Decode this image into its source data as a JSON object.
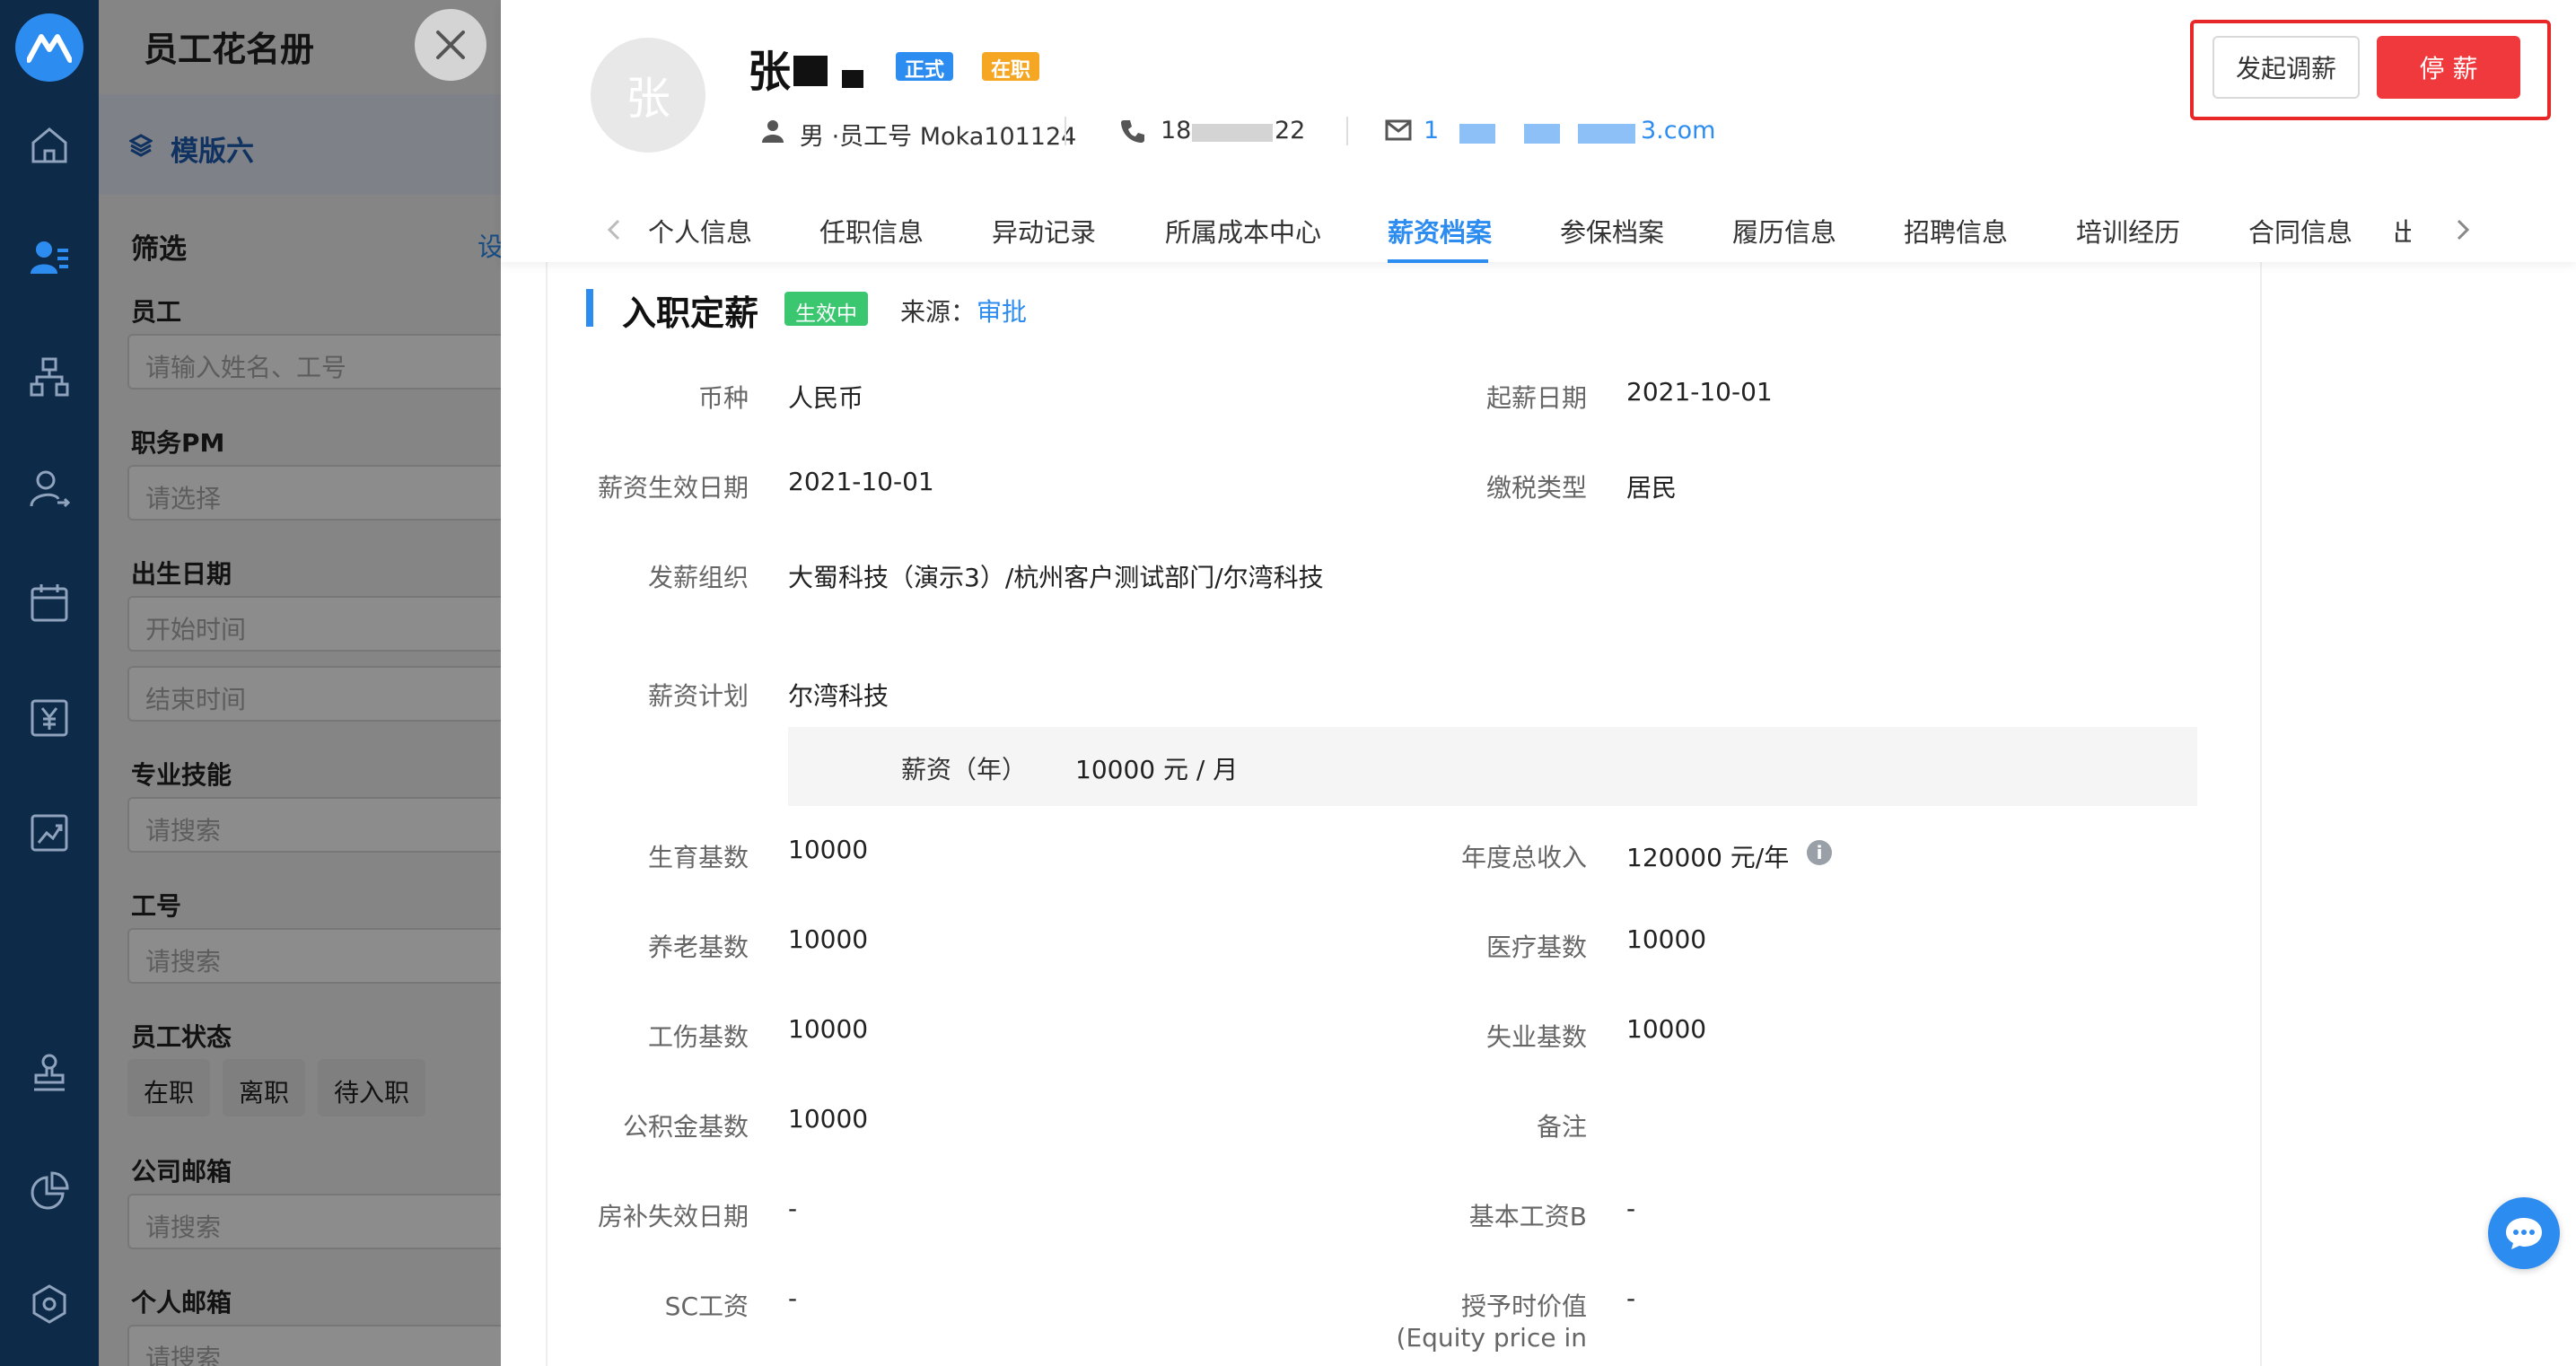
{
  "sidebar": {
    "items": [
      {
        "name": "home-icon"
      },
      {
        "name": "employee-roster-icon"
      },
      {
        "name": "org-chart-icon"
      },
      {
        "name": "onboarding-icon"
      },
      {
        "name": "calendar-icon"
      },
      {
        "name": "payroll-icon"
      },
      {
        "name": "report-icon"
      },
      {
        "name": "stamp-icon"
      },
      {
        "name": "pie-chart-icon"
      },
      {
        "name": "settings-icon"
      }
    ]
  },
  "panel": {
    "title": "员工花名册",
    "template": "模版六",
    "filter_title": "筛选",
    "filter_settings": "设",
    "employee_label": "员工",
    "employee_placeholder": "请输入姓名、工号",
    "position_label": "职务PM",
    "position_placeholder": "请选择",
    "birth_label": "出生日期",
    "birth_start": "开始时间",
    "birth_end": "结束时间",
    "skills_label": "专业技能",
    "skills_placeholder": "请搜索",
    "emp_no_label": "工号",
    "emp_no_placeholder": "请搜索",
    "status_label": "员工状态",
    "status_chips": [
      "在职",
      "离职",
      "待入职"
    ],
    "company_email_label": "公司邮箱",
    "company_email_placeholder": "请搜索",
    "personal_email_label": "个人邮箱",
    "personal_email_placeholder": "请搜索"
  },
  "employee": {
    "avatar_char": "张",
    "name": "张",
    "badge_formal": "正式",
    "badge_active": "在职",
    "gender_empno": "男 ·员工号 Moka101124",
    "phone_start": "18",
    "phone_end": "22",
    "email_start": "1",
    "email_end": "3.com"
  },
  "actions": {
    "adjust": "发起调薪",
    "stop": "停 薪"
  },
  "tabs": [
    "个人信息",
    "任职信息",
    "异动记录",
    "所属成本中心",
    "薪资档案",
    "参保档案",
    "履历信息",
    "招聘信息",
    "培训经历",
    "合同信息"
  ],
  "tab_overflow": "出",
  "active_tab": "薪资档案",
  "section": {
    "title": "入职定薪",
    "status": "生效中",
    "source_label": "来源：",
    "source_value": "审批"
  },
  "fields": {
    "currency_label": "币种",
    "currency": "人民币",
    "start_date_label": "起薪日期",
    "start_date": "2021-10-01",
    "effective_date_label": "薪资生效日期",
    "effective_date": "2021-10-01",
    "tax_type_label": "缴税类型",
    "tax_type": "居民",
    "org_label": "发薪组织",
    "org": "大蜀科技（演示3）/杭州客户测试部门/尔湾科技",
    "plan_label": "薪资计划",
    "plan": "尔湾科技",
    "salary_label": "薪资（年）",
    "salary": "10000 元 / 月",
    "maternity_label": "生育基数",
    "maternity": "10000",
    "annual_label": "年度总收入",
    "annual": "120000 元/年",
    "pension_label": "养老基数",
    "pension": "10000",
    "medical_label": "医疗基数",
    "medical": "10000",
    "injury_label": "工伤基数",
    "injury": "10000",
    "unemployment_label": "失业基数",
    "unemployment": "10000",
    "housing_fund_label": "公积金基数",
    "housing_fund": "10000",
    "remark_label": "备注",
    "remark": "",
    "housing_end_label": "房补失效日期",
    "housing_end": "-",
    "base_b_label": "基本工资B",
    "base_b": "-",
    "sc_label": "SC工资",
    "sc": "-",
    "grant_label": "授予时价值",
    "grant_sub": "(Equity price in",
    "grant": "-"
  }
}
